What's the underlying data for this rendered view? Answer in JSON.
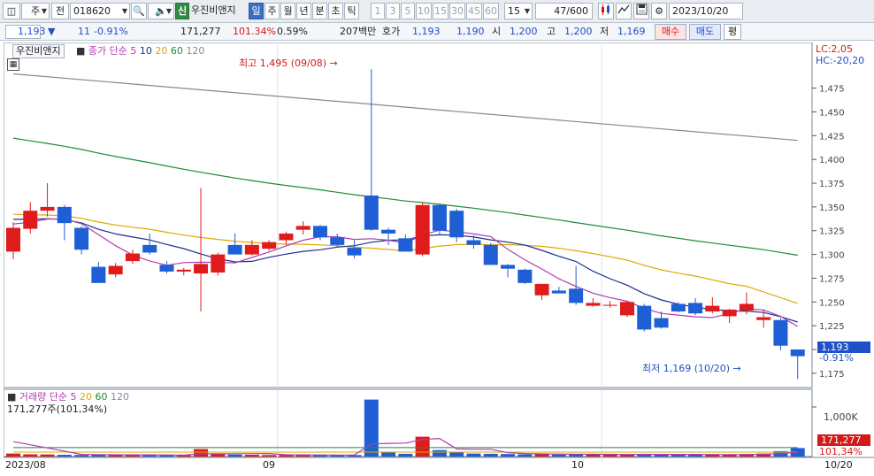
{
  "toolbar": {
    "market_label": "주",
    "type_label": "전",
    "code": "018620",
    "stock_badge": "신",
    "stock_name": "우진비앤지",
    "periods": [
      "일",
      "주",
      "월",
      "년",
      "분",
      "초",
      "틱"
    ],
    "intervals": [
      "1",
      "3",
      "5",
      "10",
      "15",
      "30",
      "45",
      "60"
    ],
    "interval_value": "15",
    "count": "47/600",
    "date": "2023/10/20"
  },
  "quote": {
    "price": "1,193",
    "change_arrow": "▼",
    "change": "11",
    "change_rate": "-0.91%",
    "volume": "171,277",
    "volume_ratio": "101.34%",
    "turnover_rate": "0.59%",
    "amount": "207백만",
    "bid_label": "호가",
    "ask_price": "1,193",
    "bid_price": "1,190",
    "open_label": "시",
    "open": "1,200",
    "high_label": "고",
    "high": "1,200",
    "low_label": "저",
    "low": "1,169",
    "buy_label": "매수",
    "sell_label": "매도",
    "eval_label": "평"
  },
  "price_panel": {
    "stock_tag": "우진비앤지",
    "legend_prefix": "종가 단순",
    "legend_values": [
      "5",
      "10",
      "20",
      "60",
      "120"
    ],
    "legend_colors": [
      "#b03cb0",
      "#1b2f8f",
      "#e0a800",
      "#1e8a3c",
      "#888888"
    ],
    "lc_text": "LC:2,05",
    "hc_text": "HC:-20,20",
    "max_annotation": "최고 1,495 (09/08) →",
    "min_annotation": "최저 1,169 (10/20) →",
    "current_price_tag": "1,193",
    "current_rate_tag": "-0.91%"
  },
  "volume_panel": {
    "legend_prefix": "거래량 단순",
    "legend_values": [
      "5",
      "20",
      "60",
      "120"
    ],
    "legend_colors": [
      "#b03cb0",
      "#e0a800",
      "#1e8a3c",
      "#888888"
    ],
    "info": "171,277주(101,34%)",
    "axis_label": "1,000K",
    "current_volume_tag": "171,277",
    "current_rate_tag": "101,34%"
  },
  "x_axis": {
    "labels": [
      "2023/08",
      "09",
      "10",
      "10/20"
    ]
  },
  "chart_data": {
    "type": "candlestick",
    "ylim": [
      1160,
      1510
    ],
    "y_ticks": [
      1175,
      1200,
      1225,
      1250,
      1275,
      1300,
      1325,
      1350,
      1375,
      1400,
      1425,
      1450,
      1475
    ],
    "volume_ylim": [
      0,
      1250000
    ],
    "volume_ticks": [
      1000000
    ],
    "candles": [
      {
        "o": 1303,
        "h": 1334,
        "l": 1295,
        "c": 1328,
        "v": 60000
      },
      {
        "o": 1327,
        "h": 1355,
        "l": 1322,
        "c": 1346,
        "v": 45000
      },
      {
        "o": 1346,
        "h": 1375,
        "l": 1340,
        "c": 1350,
        "v": 42000
      },
      {
        "o": 1350,
        "h": 1352,
        "l": 1315,
        "c": 1333,
        "v": 35000
      },
      {
        "o": 1328,
        "h": 1330,
        "l": 1300,
        "c": 1305,
        "v": 32000
      },
      {
        "o": 1287,
        "h": 1292,
        "l": 1278,
        "c": 1270,
        "v": 40000
      },
      {
        "o": 1279,
        "h": 1291,
        "l": 1276,
        "c": 1288,
        "v": 30000
      },
      {
        "o": 1293,
        "h": 1305,
        "l": 1290,
        "c": 1301,
        "v": 34000
      },
      {
        "o": 1310,
        "h": 1322,
        "l": 1300,
        "c": 1302,
        "v": 30000
      },
      {
        "o": 1289,
        "h": 1293,
        "l": 1280,
        "c": 1282,
        "v": 28000
      },
      {
        "o": 1282,
        "h": 1286,
        "l": 1278,
        "c": 1284,
        "v": 25000
      },
      {
        "o": 1280,
        "h": 1370,
        "l": 1240,
        "c": 1290,
        "v": 150000
      },
      {
        "o": 1281,
        "h": 1302,
        "l": 1278,
        "c": 1300,
        "v": 45000
      },
      {
        "o": 1310,
        "h": 1322,
        "l": 1300,
        "c": 1300,
        "v": 40000
      },
      {
        "o": 1300,
        "h": 1315,
        "l": 1299,
        "c": 1310,
        "v": 35000
      },
      {
        "o": 1306,
        "h": 1315,
        "l": 1304,
        "c": 1313,
        "v": 30000
      },
      {
        "o": 1315,
        "h": 1324,
        "l": 1310,
        "c": 1322,
        "v": 32000
      },
      {
        "o": 1326,
        "h": 1335,
        "l": 1321,
        "c": 1330,
        "v": 31000
      },
      {
        "o": 1330,
        "h": 1331,
        "l": 1315,
        "c": 1318,
        "v": 30000
      },
      {
        "o": 1318,
        "h": 1322,
        "l": 1308,
        "c": 1310,
        "v": 28000
      },
      {
        "o": 1307,
        "h": 1315,
        "l": 1296,
        "c": 1299,
        "v": 30000
      },
      {
        "o": 1362,
        "h": 1495,
        "l": 1325,
        "c": 1326,
        "v": 1150000
      },
      {
        "o": 1326,
        "h": 1328,
        "l": 1310,
        "c": 1322,
        "v": 90000
      },
      {
        "o": 1317,
        "h": 1321,
        "l": 1305,
        "c": 1303,
        "v": 55000
      },
      {
        "o": 1300,
        "h": 1355,
        "l": 1298,
        "c": 1352,
        "v": 400000
      },
      {
        "o": 1352,
        "h": 1353,
        "l": 1320,
        "c": 1325,
        "v": 130000
      },
      {
        "o": 1346,
        "h": 1348,
        "l": 1313,
        "c": 1318,
        "v": 90000
      },
      {
        "o": 1315,
        "h": 1320,
        "l": 1306,
        "c": 1310,
        "v": 60000
      },
      {
        "o": 1310,
        "h": 1312,
        "l": 1289,
        "c": 1289,
        "v": 55000
      },
      {
        "o": 1289,
        "h": 1290,
        "l": 1276,
        "c": 1285,
        "v": 50000
      },
      {
        "o": 1284,
        "h": 1285,
        "l": 1269,
        "c": 1270,
        "v": 45000
      },
      {
        "o": 1257,
        "h": 1269,
        "l": 1252,
        "c": 1269,
        "v": 60000
      },
      {
        "o": 1262,
        "h": 1266,
        "l": 1259,
        "c": 1259,
        "v": 40000
      },
      {
        "o": 1264,
        "h": 1288,
        "l": 1247,
        "c": 1249,
        "v": 50000
      },
      {
        "o": 1246,
        "h": 1254,
        "l": 1245,
        "c": 1249,
        "v": 38000
      },
      {
        "o": 1246,
        "h": 1251,
        "l": 1244,
        "c": 1247,
        "v": 36000
      },
      {
        "o": 1236,
        "h": 1251,
        "l": 1234,
        "c": 1250,
        "v": 45000
      },
      {
        "o": 1246,
        "h": 1248,
        "l": 1219,
        "c": 1221,
        "v": 50000
      },
      {
        "o": 1233,
        "h": 1240,
        "l": 1222,
        "c": 1223,
        "v": 42000
      },
      {
        "o": 1248,
        "h": 1250,
        "l": 1239,
        "c": 1240,
        "v": 40000
      },
      {
        "o": 1249,
        "h": 1254,
        "l": 1236,
        "c": 1238,
        "v": 38000
      },
      {
        "o": 1240,
        "h": 1255,
        "l": 1238,
        "c": 1246,
        "v": 36000
      },
      {
        "o": 1235,
        "h": 1243,
        "l": 1228,
        "c": 1242,
        "v": 42000
      },
      {
        "o": 1241,
        "h": 1260,
        "l": 1237,
        "c": 1248,
        "v": 50000
      },
      {
        "o": 1231,
        "h": 1242,
        "l": 1223,
        "c": 1234,
        "v": 60000
      },
      {
        "o": 1231,
        "h": 1233,
        "l": 1199,
        "c": 1204,
        "v": 110000
      },
      {
        "o": 1200,
        "h": 1200,
        "l": 1169,
        "c": 1193,
        "v": 171277
      }
    ],
    "ma120": {
      "x0": 0,
      "x1": 46,
      "y0": 1490,
      "y1": 1420
    },
    "vol_ma60_level": 180000,
    "vol_ma20_level": 90000
  }
}
